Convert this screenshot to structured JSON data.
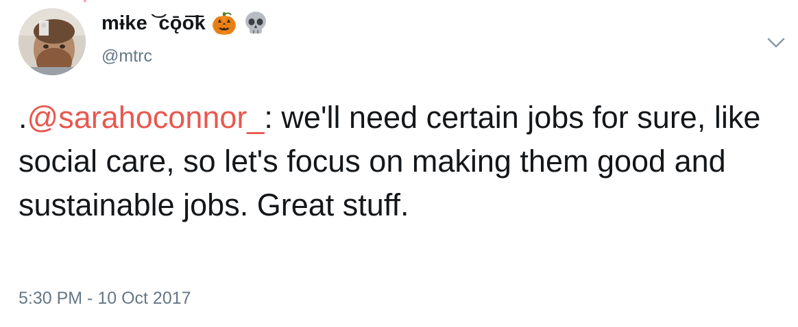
{
  "author": {
    "display_name": "mɨke ͝ cǭo͞k",
    "handle": "@mtrc",
    "emoji": [
      "pumpkin-emoji",
      "skull-emoji"
    ]
  },
  "tweet": {
    "prefix": ".",
    "mention": "@sarahoconnor_",
    "body": ": we'll need certain jobs for sure, like social care, so let's focus on making them good and sustainable jobs. Great stuff.",
    "timestamp": "5:30 PM - 10 Oct 2017"
  },
  "icons": {
    "menu": "chevron-down-icon"
  },
  "colors": {
    "text": "#14171a",
    "secondary": "#657786",
    "mention": "#e8584f"
  }
}
